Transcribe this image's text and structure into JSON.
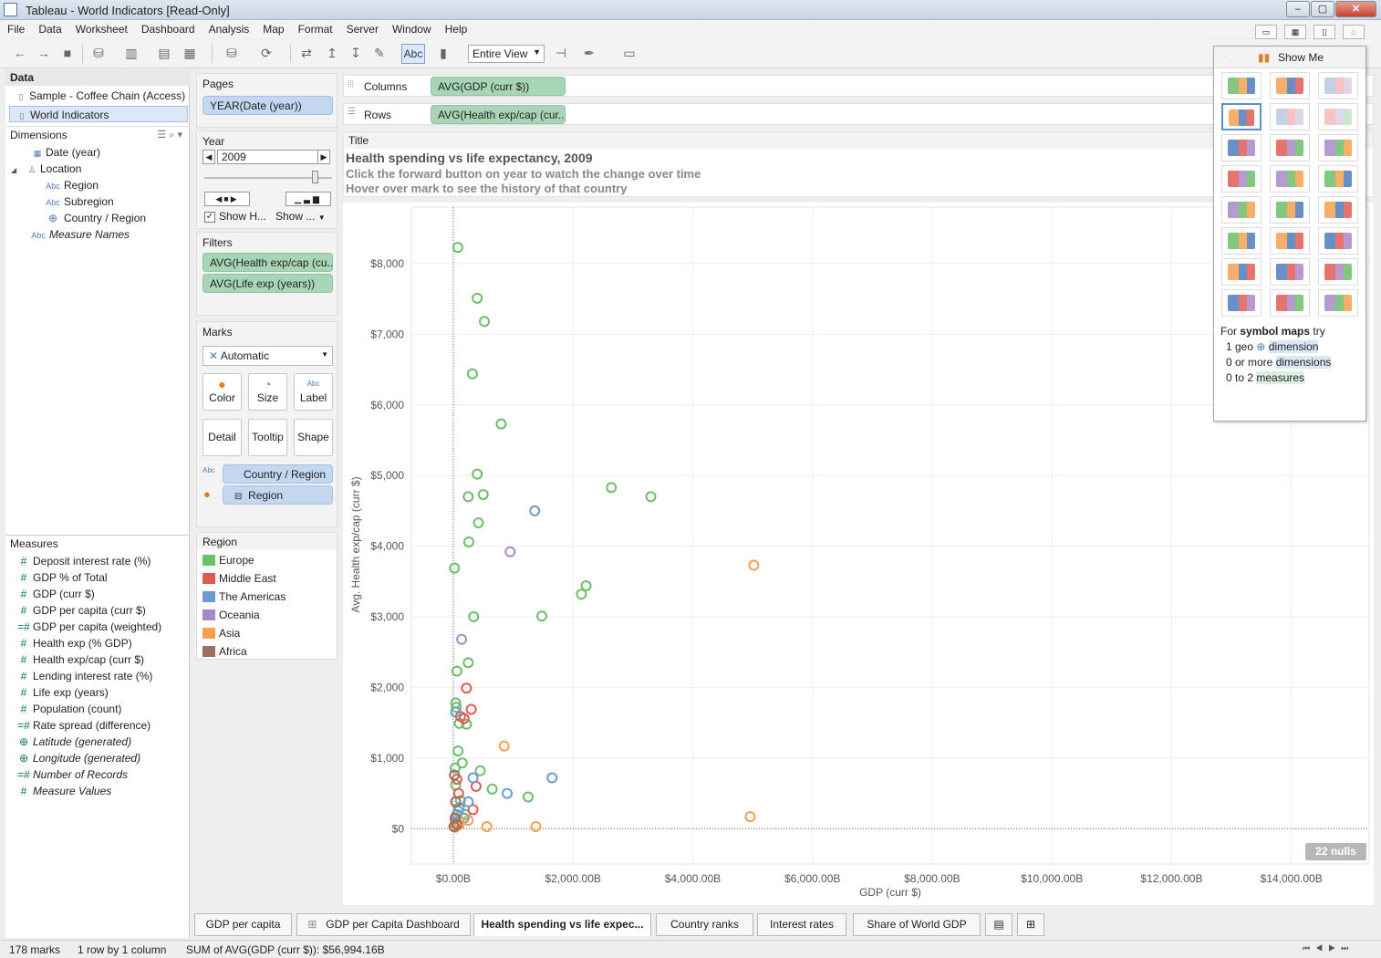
{
  "window": {
    "title": "Tableau - World Indicators [Read-Only]"
  },
  "menu": [
    "File",
    "Data",
    "Worksheet",
    "Dashboard",
    "Analysis",
    "Map",
    "Format",
    "Server",
    "Window",
    "Help"
  ],
  "toolbar": {
    "abc_label": "Abc",
    "fit_value": "Entire View"
  },
  "data_pane": {
    "header": "Data",
    "sources": [
      "Sample - Coffee Chain (Access)",
      "World Indicators"
    ],
    "dimensions_header": "Dimensions",
    "dimensions": [
      {
        "label": "Date (year)",
        "icon": "calendar-icon"
      },
      {
        "label": "Location",
        "icon": "hierarchy-icon"
      },
      {
        "label": "Region",
        "icon": "abc"
      },
      {
        "label": "Subregion",
        "icon": "abc"
      },
      {
        "label": "Country / Region",
        "icon": "globe-icon"
      },
      {
        "label": "Measure Names",
        "icon": "abc"
      }
    ],
    "measures_header": "Measures",
    "measures": [
      "Deposit interest rate (%)",
      "GDP % of Total",
      "GDP (curr $)",
      "GDP per capita (curr $)",
      "GDP per capita (weighted)",
      "Health exp (% GDP)",
      "Health exp/cap (curr $)",
      "Lending interest rate (%)",
      "Life exp (years)",
      "Population (count)",
      "Rate spread (difference)",
      "Latitude (generated)",
      "Longitude (generated)",
      "Number of Records",
      "Measure Values"
    ]
  },
  "pages": {
    "header": "Pages",
    "pill": "YEAR(Date (year))"
  },
  "year_card": {
    "header": "Year",
    "value": "2009",
    "show_history": "Show H...",
    "show": "Show ..."
  },
  "filters": {
    "header": "Filters",
    "pills": [
      "AVG(Health exp/cap (cu..",
      "AVG(Life exp (years))"
    ]
  },
  "marks": {
    "header": "Marks",
    "type": "Automatic",
    "buttons": [
      "Color",
      "Size",
      "Label",
      "Detail",
      "Tooltip",
      "Shape"
    ],
    "pills": [
      "Country / Region",
      "Region"
    ]
  },
  "legend": {
    "header": "Region",
    "items": [
      {
        "label": "Europe",
        "color": "#6cbf68"
      },
      {
        "label": "Middle East",
        "color": "#e15a54"
      },
      {
        "label": "The Americas",
        "color": "#6b9bd1"
      },
      {
        "label": "Oceania",
        "color": "#a889c8"
      },
      {
        "label": "Asia",
        "color": "#f6a04d"
      },
      {
        "label": "Africa",
        "color": "#9e6e62"
      }
    ]
  },
  "shelves": {
    "columns_label": "Columns",
    "columns_pill": "AVG(GDP (curr $))",
    "rows_label": "Rows",
    "rows_pill": "AVG(Health exp/cap (cur.."
  },
  "title_card": {
    "header": "Title",
    "title": "Health spending vs life expectancy, 2009",
    "line1": "Click the forward button on year to watch the change over time",
    "line2": "Hover over mark to see the history of that country"
  },
  "show_me": {
    "header": "Show Me",
    "hint_prefix": "For ",
    "hint_bold": "symbol maps",
    "hint_suffix": " try",
    "req1_a": "1 geo ",
    "req1_b": "dimension",
    "req2_a": "0 or more ",
    "req2_b": "dimensions",
    "req3_a": "0 to 2 ",
    "req3_b": "measures"
  },
  "chart_data": {
    "type": "scatter",
    "title": "",
    "xlabel": "GDP (curr $)",
    "ylabel": "Avg. Health exp/cap (curr $)",
    "xlim": [
      -700,
      15300
    ],
    "ylim": [
      -500,
      8800
    ],
    "x_ticks": [
      "$0.00B",
      "$2,000.00B",
      "$4,000.00B",
      "$6,000.00B",
      "$8,000.00B",
      "$10,000.00B",
      "$12,000.00B",
      "$14,000.00B"
    ],
    "x_tick_values": [
      0,
      2000,
      4000,
      6000,
      8000,
      10000,
      12000,
      14000
    ],
    "y_ticks": [
      "$0",
      "$1,000",
      "$2,000",
      "$3,000",
      "$4,000",
      "$5,000",
      "$6,000",
      "$7,000",
      "$8,000"
    ],
    "y_tick_values": [
      0,
      1000,
      2000,
      3000,
      4000,
      5000,
      6000,
      7000,
      8000
    ],
    "marker": "open-circle",
    "grid": true,
    "series": [
      {
        "name": "Europe",
        "color": "#6cbf68",
        "points": [
          [
            75,
            8230
          ],
          [
            400,
            7510
          ],
          [
            520,
            7180
          ],
          [
            320,
            6440
          ],
          [
            800,
            5730
          ],
          [
            400,
            5020
          ],
          [
            250,
            4700
          ],
          [
            500,
            4730
          ],
          [
            420,
            4330
          ],
          [
            260,
            4060
          ],
          [
            20,
            3690
          ],
          [
            2640,
            4830
          ],
          [
            3300,
            4700
          ],
          [
            2220,
            3440
          ],
          [
            2140,
            3320
          ],
          [
            1480,
            3010
          ],
          [
            340,
            3000
          ],
          [
            250,
            2350
          ],
          [
            60,
            2230
          ],
          [
            40,
            1780
          ],
          [
            50,
            1720
          ],
          [
            100,
            1490
          ],
          [
            220,
            1480
          ],
          [
            80,
            1100
          ],
          [
            150,
            930
          ],
          [
            450,
            820
          ],
          [
            650,
            560
          ],
          [
            40,
            620
          ],
          [
            120,
            400
          ],
          [
            80,
            250
          ],
          [
            200,
            200
          ],
          [
            40,
            100
          ],
          [
            1250,
            450
          ],
          [
            30,
            860
          ]
        ]
      },
      {
        "name": "Middle East",
        "color": "#e15a54",
        "points": [
          [
            220,
            1990
          ],
          [
            300,
            1690
          ],
          [
            120,
            1590
          ],
          [
            180,
            1560
          ],
          [
            380,
            600
          ],
          [
            330,
            270
          ],
          [
            60,
            700
          ],
          [
            90,
            500
          ],
          [
            30,
            150
          ]
        ]
      },
      {
        "name": "The Americas",
        "color": "#6b9bd1",
        "points": [
          [
            1360,
            4500
          ],
          [
            1650,
            720
          ],
          [
            900,
            500
          ],
          [
            40,
            1650
          ],
          [
            330,
            720
          ],
          [
            250,
            380
          ],
          [
            100,
            300
          ],
          [
            60,
            200
          ],
          [
            180,
            150
          ]
        ]
      },
      {
        "name": "Oceania",
        "color": "#a889c8",
        "points": [
          [
            950,
            3920
          ],
          [
            140,
            2680
          ],
          [
            40,
            80
          ]
        ]
      },
      {
        "name": "Asia",
        "color": "#f6a04d",
        "points": [
          [
            5020,
            3730
          ],
          [
            4960,
            170
          ],
          [
            850,
            1170
          ],
          [
            560,
            30
          ],
          [
            1380,
            30
          ],
          [
            250,
            120
          ],
          [
            100,
            60
          ],
          [
            60,
            40
          ],
          [
            30,
            20
          ]
        ]
      },
      {
        "name": "Africa",
        "color": "#9e6e62",
        "points": [
          [
            20,
            760
          ],
          [
            40,
            380
          ],
          [
            30,
            150
          ],
          [
            60,
            60
          ],
          [
            10,
            30
          ]
        ]
      }
    ]
  },
  "nulls_badge": "22 nulls",
  "sheet_tabs": [
    "GDP per capita",
    "GDP per Capita Dashboard",
    "Health spending vs life expec...",
    "Country ranks",
    "Interest rates",
    "Share of World GDP"
  ],
  "status": {
    "marks": "178 marks",
    "rows": "1 row by 1 column",
    "sum": "SUM of AVG(GDP (curr $)): $56,994.16B"
  }
}
